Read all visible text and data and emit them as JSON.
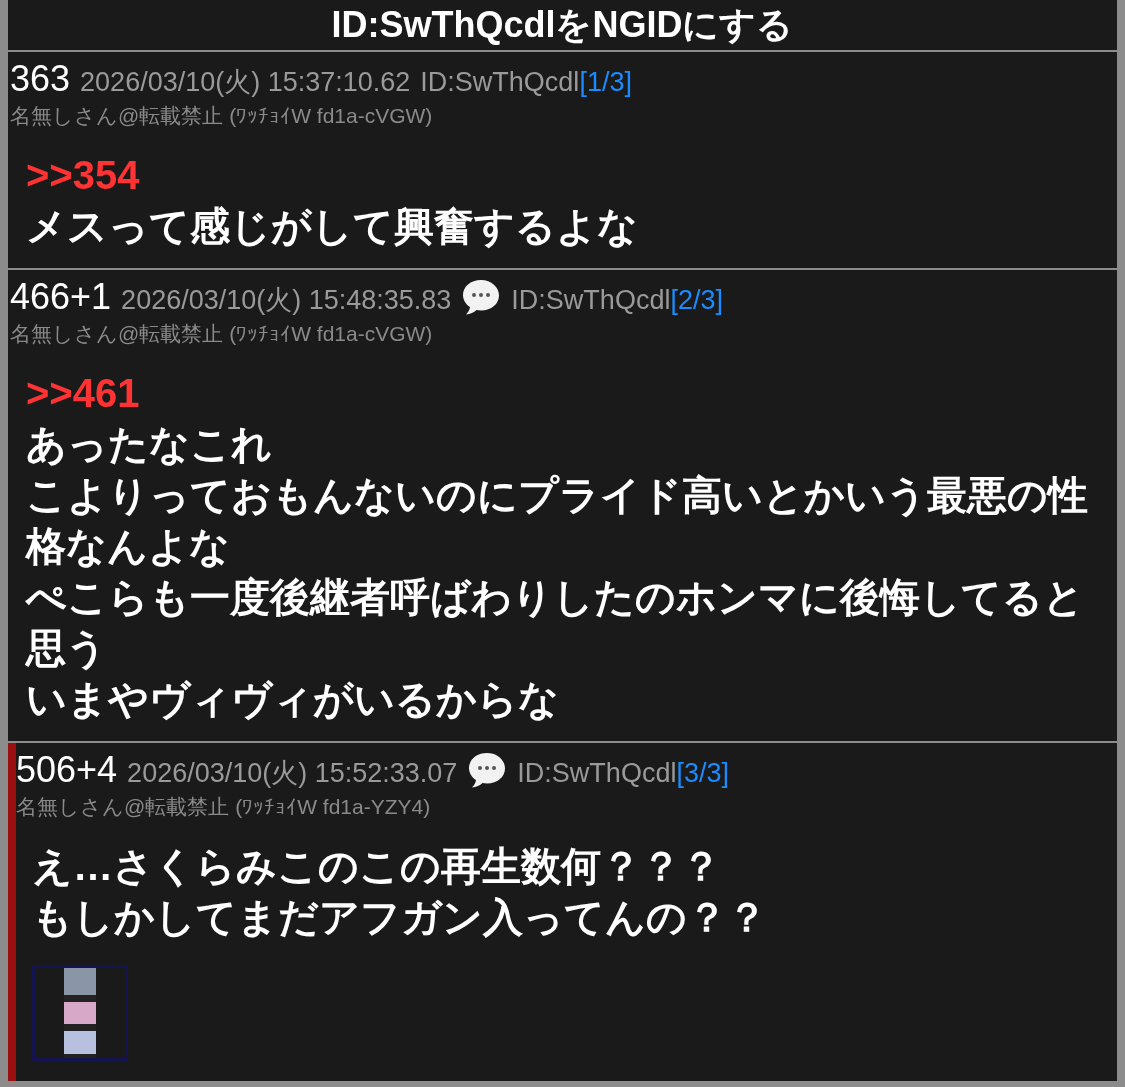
{
  "title": "ID:SwThQcdlをNGIDにする",
  "posts": [
    {
      "number": "363",
      "datetime": "2026/03/10(火) 15:37:10.62",
      "has_replies": false,
      "id": "ID:SwThQcdl",
      "count": "[1/3]",
      "name": "名無しさん@転載禁止 (ﾜｯﾁｮｲW fd1a-cVGW)",
      "highlighted": false,
      "anchor": ">>354",
      "lines": [
        "メスって感じがして興奮するよな"
      ]
    },
    {
      "number": "466+1",
      "datetime": "2026/03/10(火) 15:48:35.83",
      "has_replies": true,
      "id": "ID:SwThQcdl",
      "count": "[2/3]",
      "name": "名無しさん@転載禁止 (ﾜｯﾁｮｲW fd1a-cVGW)",
      "highlighted": false,
      "anchor": ">>461",
      "lines": [
        "あったなこれ",
        "こよりっておもんないのにプライド高いとかいう最悪の性格なんよな",
        "ぺこらも一度後継者呼ばわりしたのホンマに後悔してると思う",
        "いまやヴィヴィがいるからな"
      ]
    },
    {
      "number": "506+4",
      "datetime": "2026/03/10(火) 15:52:33.07",
      "has_replies": true,
      "id": "ID:SwThQcdl",
      "count": "[3/3]",
      "name": "名無しさん@転載禁止 (ﾜｯﾁｮｲW fd1a-YZY4)",
      "highlighted": true,
      "lines": [
        "え…さくらみこのこの再生数何？？？",
        "もしかしてまだアフガン入ってんの？？"
      ],
      "thumbnail": true
    }
  ]
}
